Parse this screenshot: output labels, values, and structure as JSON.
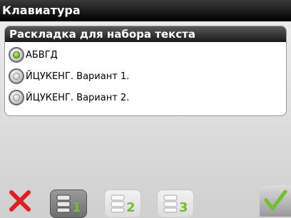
{
  "window": {
    "title": "Клавиатура"
  },
  "panel": {
    "header": "Раскладка для набора текста",
    "options": [
      {
        "label": "АБВГД",
        "selected": true
      },
      {
        "label": "ЙЦУКЕНГ. Вариант 1.",
        "selected": false
      },
      {
        "label": "ЙЦУКЕНГ. Вариант 2.",
        "selected": false
      }
    ]
  },
  "toolbar": {
    "cancel_icon": "close-x-icon",
    "confirm_icon": "checkmark-icon",
    "layouts": [
      {
        "number": "1",
        "active": true
      },
      {
        "number": "2",
        "active": false
      },
      {
        "number": "3",
        "active": false
      }
    ]
  },
  "colors": {
    "accent_green": "#6fbf2e",
    "cancel_red": "#e02020",
    "header_dark": "#1a1a1a"
  }
}
